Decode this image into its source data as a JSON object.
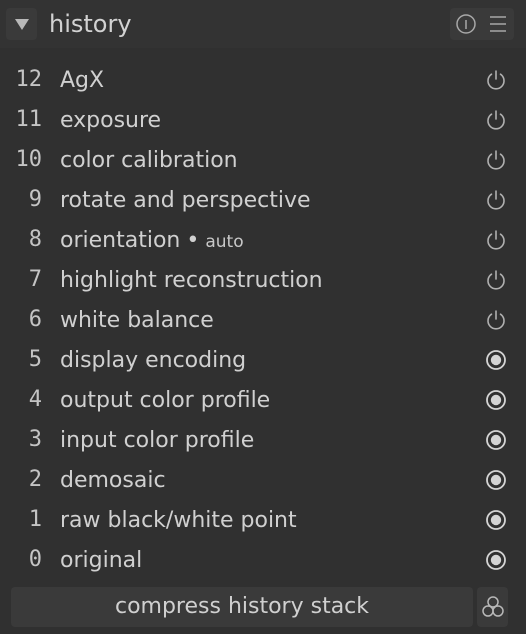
{
  "panel": {
    "title": "history",
    "collapse_icon": "triangle-down-icon",
    "header_icons": [
      "info-icon",
      "hamburger-menu-icon"
    ]
  },
  "history": {
    "items": [
      {
        "num": "12",
        "label": "AgX",
        "note": "",
        "state": "power-icon"
      },
      {
        "num": "11",
        "label": "exposure",
        "note": "",
        "state": "power-icon"
      },
      {
        "num": "10",
        "label": "color calibration",
        "note": "",
        "state": "power-icon"
      },
      {
        "num": "9",
        "label": "rotate and perspective",
        "note": "",
        "state": "power-icon"
      },
      {
        "num": "8",
        "label": "orientation",
        "sep": "•",
        "note": "auto",
        "state": "power-icon"
      },
      {
        "num": "7",
        "label": "highlight reconstruction",
        "note": "",
        "state": "power-icon"
      },
      {
        "num": "6",
        "label": "white balance",
        "note": "",
        "state": "power-icon"
      },
      {
        "num": "5",
        "label": "display encoding",
        "note": "",
        "state": "always-on-icon"
      },
      {
        "num": "4",
        "label": "output color profile",
        "note": "",
        "state": "always-on-icon"
      },
      {
        "num": "3",
        "label": "input color profile",
        "note": "",
        "state": "always-on-icon"
      },
      {
        "num": "2",
        "label": "demosaic",
        "note": "",
        "state": "always-on-icon"
      },
      {
        "num": "1",
        "label": "raw black/white point",
        "note": "",
        "state": "always-on-icon"
      },
      {
        "num": "0",
        "label": "original",
        "note": "",
        "state": "always-on-icon"
      }
    ]
  },
  "footer": {
    "compress_label": "compress history stack",
    "compare_icon": "compare-circles-icon"
  },
  "colors": {
    "background": "#303030",
    "button": "#3a3a3a",
    "text": "#d0d0d0"
  }
}
